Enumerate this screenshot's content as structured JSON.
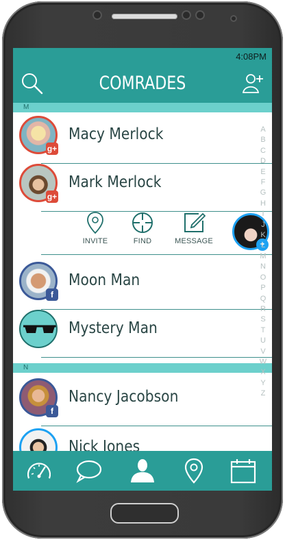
{
  "status": {
    "time": "4:08PM"
  },
  "header": {
    "title": "COMRADES",
    "search_icon": "search-icon",
    "add_icon": "add-user-icon"
  },
  "sections": [
    {
      "letter": "M",
      "contacts": [
        {
          "name": "Macy Merlock",
          "network": "google-plus",
          "badge": "g+"
        },
        {
          "name": "Mark Merlock",
          "network": "google-plus",
          "badge": "g+"
        },
        {
          "name": "Moon Man",
          "network": "facebook",
          "badge": "f"
        },
        {
          "name": "Mystery Man",
          "network": "none",
          "badge": ""
        }
      ]
    },
    {
      "letter": "N",
      "contacts": [
        {
          "name": "Nancy Jacobson",
          "network": "facebook",
          "badge": "f"
        },
        {
          "name": "Nick Jones",
          "network": "twitter",
          "badge": ""
        }
      ]
    }
  ],
  "actions": [
    {
      "label": "INVITE",
      "icon": "map-pin-icon"
    },
    {
      "label": "FIND",
      "icon": "crosshair-icon"
    },
    {
      "label": "MESSAGE",
      "icon": "edit-icon"
    }
  ],
  "alphabet": [
    "A",
    "B",
    "C",
    "D",
    "E",
    "F",
    "G",
    "H",
    "I",
    "J",
    "K",
    "L",
    "M",
    "N",
    "O",
    "P",
    "Q",
    "R",
    "S",
    "T",
    "U",
    "V",
    "W",
    "X",
    "Y",
    "Z"
  ],
  "bottom_nav": [
    "speedometer-icon",
    "chat-icon",
    "person-icon",
    "location-pin-icon",
    "calendar-icon"
  ],
  "colors": {
    "primary": "#2a9d97",
    "section_header": "#6cd0cc",
    "divider": "#3d8f8b",
    "google_plus": "#dd4b39",
    "facebook": "#3b5998",
    "twitter": "#1da1f2"
  }
}
